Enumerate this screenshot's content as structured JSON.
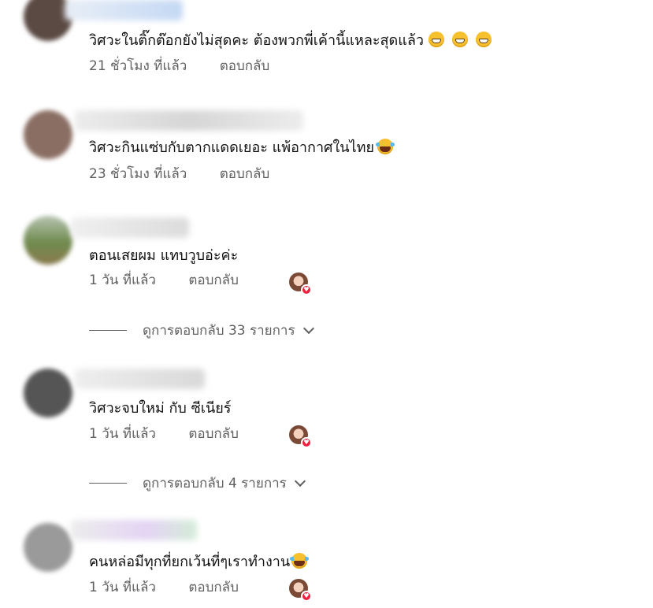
{
  "comments": [
    {
      "text": "วิศวะในติ๊กต๊อกยังไม่สุดคะ ต้องพวกพี่เค้านี้แหละสุดแล้ว",
      "time": "21 ชั่วโมง ที่แล้ว",
      "reply": "ตอบกลับ",
      "emojis": [
        "grin-icon",
        "grin-icon",
        "grin-icon"
      ],
      "avatar_color": "#5b4a44",
      "name_blur_color": "#c9dcf5"
    },
    {
      "text": "วิศวะกินแซ่บกับตากแดดเยอะ แพ้อากาศในไทย",
      "time": "23 ชั่วโมง ที่แล้ว",
      "reply": "ตอบกลับ",
      "emojis": [
        "laughing-tears-icon"
      ],
      "avatar_color": "#8a6e63",
      "name_blur_color": "#dedede"
    },
    {
      "text": "ตอนเสยผม แทบวูบอ่ะค่ะ",
      "time": "1 วัน ที่แล้ว",
      "reply": "ตอบกลับ",
      "emojis": [],
      "creator_heart": true,
      "view_replies": "ดูการตอบกลับ 33 รายการ",
      "avatar_color": "#7b8a5a",
      "name_blur_color": "#d8d8d8"
    },
    {
      "text": "วิศวะจบใหม่ กับ ซีเนียร์",
      "time": "1 วัน ที่แล้ว",
      "reply": "ตอบกลับ",
      "emojis": [],
      "creator_heart": true,
      "view_replies": "ดูการตอบกลับ 4 รายการ",
      "avatar_color": "#555555",
      "name_blur_color": "#d8d8d8"
    },
    {
      "text": "คนหล่อมีทุกที่ยกเว้นที่ๆเราทำงาน",
      "time": "1 วัน ที่แล้ว",
      "reply": "ตอบกลับ",
      "emojis": [
        "laughing-tears-icon"
      ],
      "creator_heart": true,
      "avatar_color": "#9a9a9a",
      "name_blur_color": "#e0d8f0"
    }
  ],
  "colors": {
    "meta_text": "#606060",
    "heart_red": "#ee1f3e"
  }
}
